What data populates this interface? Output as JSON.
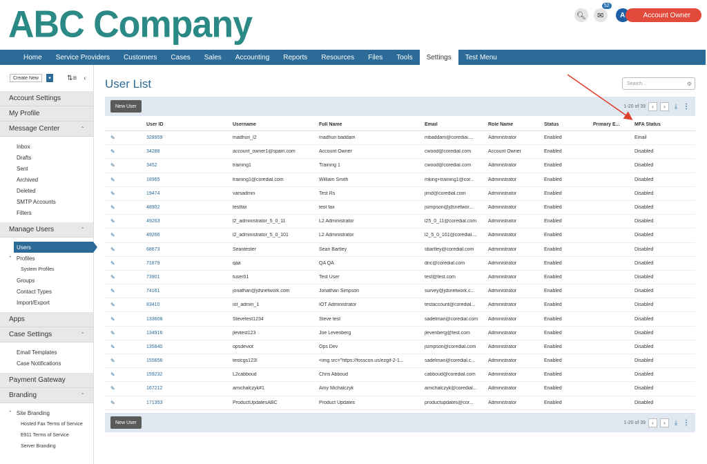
{
  "brand": {
    "logo_text": "ABC Company",
    "accent": "#2b8a86",
    "nav_color": "#2c6b98",
    "owner_color": "#e24b3b"
  },
  "header": {
    "search_icon": "search-icon",
    "mail_badge": "52",
    "avatar_letter": "A",
    "user_label": "Account Owner"
  },
  "nav": {
    "items": [
      "Home",
      "Service Providers",
      "Customers",
      "Cases",
      "Sales",
      "Accounting",
      "Reports",
      "Resources",
      "Files",
      "Tools",
      "Settings",
      "Test Menu"
    ],
    "active": "Settings"
  },
  "sidebar": {
    "create_label": "Create New",
    "account_settings": "Account Settings",
    "my_profile": "My Profile",
    "message_center": "Message Center",
    "message_items": [
      "Inbox",
      "Drafts",
      "Sent",
      "Archived",
      "Deleted",
      "SMTP Accounts",
      "Filters"
    ],
    "manage_users": "Manage Users",
    "users": "Users",
    "profiles": "Profiles",
    "system_profiles": "System Profiles",
    "groups": "Groups",
    "contact_types": "Contact Types",
    "import_export": "Import/Export",
    "apps": "Apps",
    "case_settings": "Case Settings",
    "case_items": [
      "Email Templates",
      "Case Notifications"
    ],
    "payment_gateway": "Payment Gateway",
    "branding": "Branding",
    "site_branding": "Site Branding",
    "branding_items": [
      "Hosted Fax Terms of Service",
      "E911 Terms of Service",
      "Server Branding"
    ]
  },
  "main": {
    "title": "User List",
    "search_placeholder": "Search...",
    "new_user_label": "New User",
    "pager_text": "1-20 of 39"
  },
  "table": {
    "columns": [
      "User ID",
      "Username",
      "Full Name",
      "Email",
      "Role Name",
      "Status",
      "Primary E...",
      "MFA Status"
    ],
    "rows": [
      [
        "328959",
        "madhuri_l2",
        "madhuri baddam",
        "mbaddam@corediai....",
        "Administrator",
        "Enabled",
        "",
        "Email"
      ],
      [
        "34288",
        "account_owner1@spam.com",
        "Account Owner",
        "cwood@coredial.com",
        "Account Owner",
        "Enabled",
        "",
        "Disabled"
      ],
      [
        "3452",
        "training1",
        "Training 1",
        "cwood@coredial.com",
        "Administrator",
        "Enabled",
        "",
        "Disabled"
      ],
      [
        "18965",
        "training1@coredial.com",
        "William Smith",
        "mking+training1@cor...",
        "Administrator",
        "Enabled",
        "",
        "Disabled"
      ],
      [
        "19474",
        "varsadmin",
        "Test Rs",
        "jimd@coredial.com",
        "Administrator",
        "Enabled",
        "",
        "Disabled"
      ],
      [
        "48902",
        "testfax",
        "test fax",
        "jsimpson@jdsnetwor...",
        "Administrator",
        "Enabled",
        "",
        "Disabled"
      ],
      [
        "49263",
        "l2_administrator_5_0_11",
        "L2 Administrator",
        "l25_0_11@coredial.com",
        "Administrator",
        "Enabled",
        "",
        "Disabled"
      ],
      [
        "49266",
        "l2_administrator_5_0_101",
        "L2 Administrator",
        "l2_5_0_101@coredial....",
        "Administrator",
        "Enabled",
        "",
        "Disabled"
      ],
      [
        "68673",
        "Seantester",
        "Sean Bartley",
        "sbartley@coredial.com",
        "Administrator",
        "Enabled",
        "",
        "Disabled"
      ],
      [
        "71879",
        "qaa",
        "QA QA",
        "dnc@coredial.com",
        "Administrator",
        "Enabled",
        "",
        "Disabled"
      ],
      [
        "73901",
        "tuser01",
        "Test User",
        "test@test.com",
        "Administrator",
        "Enabled",
        "",
        "Disabled"
      ],
      [
        "74161",
        "jonathan@jdsnetwork.com",
        "Jonathan Simpson",
        "survey@jdsnetwork.c...",
        "Administrator",
        "Enabled",
        "",
        "Disabled"
      ],
      [
        "83410",
        "iot_admin_1",
        "IOT Administrator",
        "testaccount@coredial...",
        "Administrator",
        "Enabled",
        "",
        "Disabled"
      ],
      [
        "133608",
        "Stevetest1234",
        "Steve test",
        "sadelman@coredial.com",
        "Administrator",
        "Enabled",
        "",
        "Disabled"
      ],
      [
        "134916",
        "jlevtest123",
        "Joe Levenberg",
        "jlevenberg@test.com",
        "Administrator",
        "Enabled",
        "",
        "Disabled"
      ],
      [
        "135840",
        "opsdeviot",
        "Ops Dev",
        "jsimpson@coredial.com",
        "Administrator",
        "Enabled",
        "",
        "Disabled"
      ],
      [
        "155656",
        "testcgs123!",
        "<img src=\"https://fosscon.us/ezgif-2-1...",
        "sadelman@coredial.c...",
        "Administrator",
        "Enabled",
        "",
        "Disabled"
      ],
      [
        "159232",
        "L2cabboud",
        "Chris Abboud",
        "cabboud@coredial.com",
        "Administrator",
        "Enabled",
        "",
        "Disabled"
      ],
      [
        "167212",
        "amichalczyk#1",
        "Amy Michalczyk",
        "amichalczyk@coredial...",
        "Administrator",
        "Enabled",
        "",
        "Disabled"
      ],
      [
        "171353",
        "ProductUpdatesABC",
        "Product Updates",
        "productupdates@cor...",
        "Administrator",
        "Enabled",
        "",
        "Disabled"
      ]
    ]
  }
}
